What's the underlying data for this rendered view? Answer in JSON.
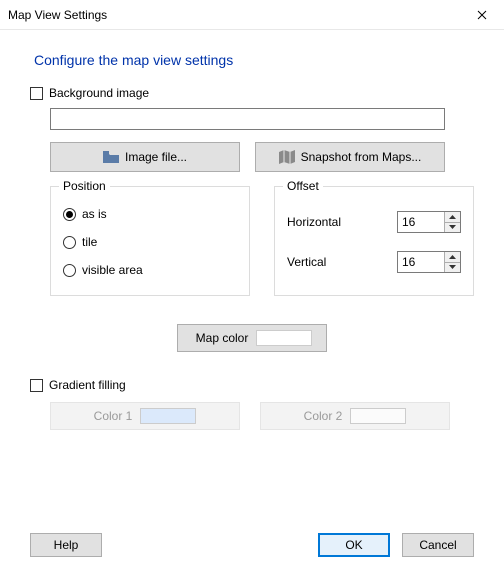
{
  "window": {
    "title": "Map View Settings"
  },
  "heading": "Configure the map view settings",
  "bgimage": {
    "checkbox_label": "Background image",
    "checked": false,
    "path": "",
    "image_file_btn": "Image file...",
    "snapshot_btn": "Snapshot from Maps..."
  },
  "position": {
    "legend": "Position",
    "options": {
      "as_is": "as is",
      "tile": "tile",
      "visible_area": "visible area"
    },
    "selected": "as_is"
  },
  "offset": {
    "legend": "Offset",
    "horizontal_label": "Horizontal",
    "horizontal_value": "16",
    "vertical_label": "Vertical",
    "vertical_value": "16"
  },
  "mapcolor": {
    "label": "Map color",
    "swatch": "#ffffff"
  },
  "gradient": {
    "checkbox_label": "Gradient filling",
    "checked": false,
    "color1_label": "Color 1",
    "color1_swatch": "#dbe9fb",
    "color2_label": "Color 2",
    "color2_swatch": "#fbfbfb"
  },
  "buttons": {
    "help": "Help",
    "ok": "OK",
    "cancel": "Cancel"
  }
}
